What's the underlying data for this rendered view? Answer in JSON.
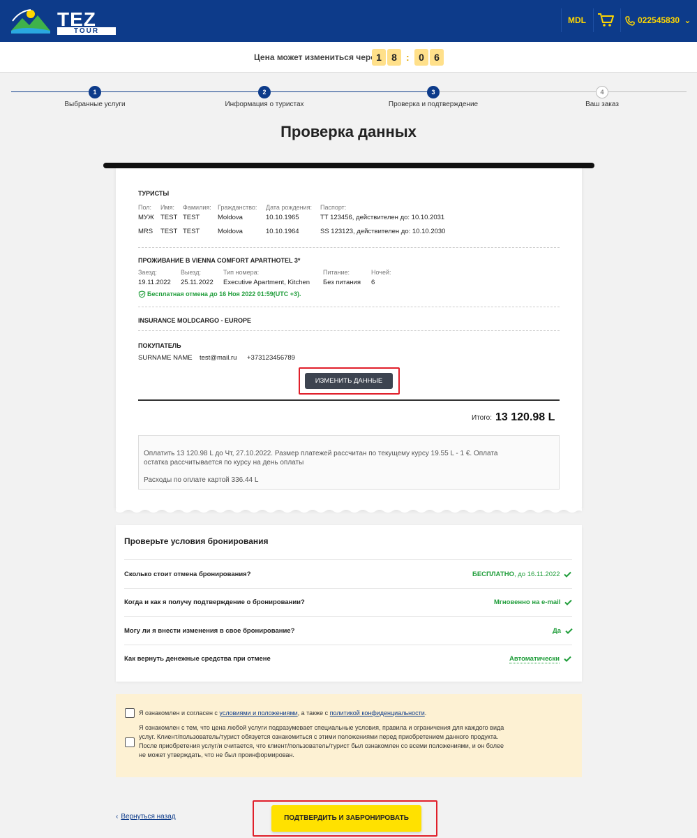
{
  "header": {
    "brand": "TEZ",
    "brand_sub": "TOUR",
    "currency": "MDL",
    "phone": "022545830",
    "phone_caret": "⌄"
  },
  "timer": {
    "label": "Цена может измениться через",
    "digits": [
      "1",
      "8",
      "0",
      "6"
    ],
    "separator": ":"
  },
  "stepper": {
    "steps": [
      {
        "num": "1",
        "label": "Выбранные услуги",
        "state": "done"
      },
      {
        "num": "2",
        "label": "Информация о туристах",
        "state": "done"
      },
      {
        "num": "3",
        "label": "Проверка и подтверждение",
        "state": "done"
      },
      {
        "num": "4",
        "label": "Ваш заказ",
        "state": "todo"
      }
    ]
  },
  "page_title": "Проверка данных",
  "tourists": {
    "heading": "ТУРИСТЫ",
    "columns": [
      "Пол:",
      "Имя:",
      "Фамилия:",
      "Гражданство:",
      "Дата рождения:",
      "Паспорт:"
    ],
    "rows": [
      [
        "МУЖ",
        "TEST",
        "TEST",
        "Moldova",
        "10.10.1965",
        "TT 123456, действителен до: 10.10.2031"
      ],
      [
        "MRS",
        "TEST",
        "TEST",
        "Moldova",
        "10.10.1964",
        "SS 123123, действителен до: 10.10.2030"
      ]
    ]
  },
  "accommodation": {
    "heading": "ПРОЖИВАНИЕ В VIENNA COMFORT APARTHOTEL 3*",
    "columns": [
      "Заезд:",
      "Выезд:",
      "Тип номера:",
      "Питание:",
      "Ночей:"
    ],
    "values": [
      "19.11.2022",
      "25.11.2022",
      "Executive Apartment, Kitchen",
      "Без питания",
      "6"
    ],
    "free_cancel": "Бесплатная отмена до 16 Ноя 2022 01:59(UTC +3)."
  },
  "insurance": {
    "heading": "INSURANCE MOLDCARGO - EUROPE"
  },
  "buyer": {
    "heading": "ПОКУПАТЕЛЬ",
    "name": "SURNAME NAME",
    "email": "test@mail.ru",
    "phone": "+373123456789"
  },
  "edit_button": "ИЗМЕНИТЬ ДАННЫЕ",
  "total": {
    "label": "Итого:",
    "value": "13 120.98 L"
  },
  "payment": {
    "line1": "Оплатить 13 120.98 L до Чт, 27.10.2022. Размер платежей рассчитан по текущему курсу 19.55 L - 1 €. Оплата",
    "line2": "остатка рассчитывается по курсу на день оплаты",
    "line3": "Расходы по оплате картой 336.44 L"
  },
  "conditions": {
    "title": "Проверьте условия бронирования",
    "rows": [
      {
        "q": "Сколько стоит отмена бронирования?",
        "a_bold": "БЕСПЛАТНО",
        "a_plain": ", до 16.11.2022"
      },
      {
        "q": "Когда и как я получу подтверждение о бронировании?",
        "a_bold": "Мгновенно на e-mail",
        "a_plain": ""
      },
      {
        "q": "Могу ли я внести изменения в свое бронирование?",
        "a_bold": "Да",
        "a_plain": ""
      },
      {
        "q": "Как вернуть денежные средства при отмене",
        "a_bold": "Автоматически",
        "a_plain": ""
      }
    ]
  },
  "agreement": {
    "a1_pre": "Я ознакомлен и согласен с ",
    "a1_link1": "условиями и положениями",
    "a1_mid": ", а также с ",
    "a1_link2": "политикой конфиденциальности",
    "a1_post": ".",
    "a2_lines": [
      "Я ознакомлен с тем, что цена любой услуги подразумевает специальные условия, правила и ограничения для каждого вида",
      "услуг. Клиент/пользователь/турист обязуется ознакомиться с этими положениями перед приобретением данного продукта.",
      "После приобретения услуг/и считается, что клиент/пользователь/турист был ознакомлен со всеми положениями, и он более",
      "не может утверждать, что не был проинформирован."
    ]
  },
  "footer": {
    "back": "Вернуться назад",
    "back_arrow": "‹",
    "confirm": "ПОДТВЕРДИТЬ И ЗАБРОНИРОВАТЬ"
  },
  "colors": {
    "header_bg": "#0d3b8a",
    "accent_yellow": "#ffd600",
    "success_green": "#1f9d3a",
    "highlight_red": "#e01f2a"
  }
}
